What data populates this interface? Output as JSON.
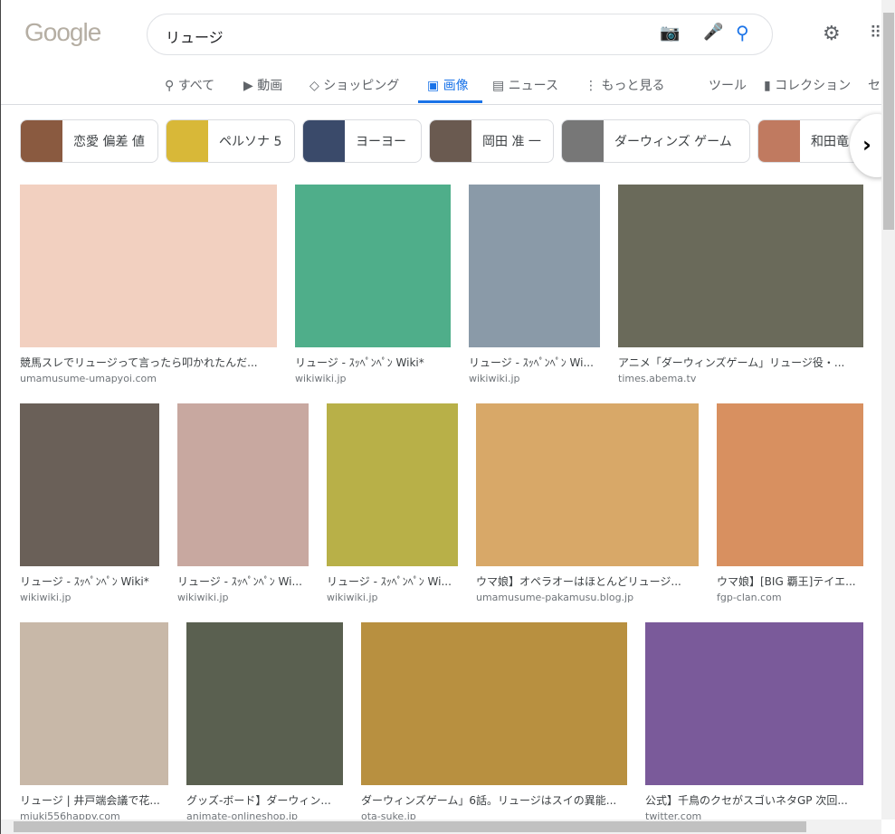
{
  "logo": "Google",
  "search": {
    "query": "リュージ"
  },
  "tabs": [
    {
      "label": "すべて",
      "icon": "search-icon"
    },
    {
      "label": "動画",
      "icon": "play-icon"
    },
    {
      "label": "ショッピング",
      "icon": "tag-icon"
    },
    {
      "label": "画像",
      "icon": "image-icon",
      "active": true
    },
    {
      "label": "ニュース",
      "icon": "news-icon"
    },
    {
      "label": "もっと見る",
      "icon": "more-icon"
    }
  ],
  "tools": {
    "tools": "ツール",
    "collection": "コレクション",
    "safe": "セ"
  },
  "chips": [
    {
      "label": "恋愛 偏差 値",
      "color": "#8a5a40"
    },
    {
      "label": "ペルソナ 5",
      "color": "#d8b838"
    },
    {
      "label": "ヨーヨー",
      "color": "#3a4a6a"
    },
    {
      "label": "岡田 准 一",
      "color": "#6a5a50"
    },
    {
      "label": "ダーウィンズ ゲーム",
      "color": "#777777"
    },
    {
      "label": "和田竜",
      "color": "#c07a60"
    }
  ],
  "results": [
    {
      "title": "競馬スレでリュージって言ったら叩かれたんだ...",
      "source": "umamusume-umapyoi.com",
      "color": "#f2d0c0"
    },
    {
      "title": "リュージ - ｽｯﾍﾟﾝﾍﾟﾝ Wiki*",
      "source": "wikiwiki.jp",
      "color": "#4fae8a"
    },
    {
      "title": "リュージ - ｽｯﾍﾟﾝﾍﾟﾝ Wi...",
      "source": "wikiwiki.jp",
      "color": "#8a9aa8"
    },
    {
      "title": "アニメ「ダーウィンズゲーム」リュージ役・...",
      "source": "times.abema.tv",
      "color": "#6a6a5a"
    },
    {
      "title": "リュージ - ｽｯﾍﾟﾝﾍﾟﾝ Wiki*",
      "source": "wikiwiki.jp",
      "color": "#6a6058"
    },
    {
      "title": "リュージ - ｽｯﾍﾟﾝﾍﾟﾝ Wi...",
      "source": "wikiwiki.jp",
      "color": "#c8a8a0"
    },
    {
      "title": "リュージ - ｽｯﾍﾟﾝﾍﾟﾝ Wi...",
      "source": "wikiwiki.jp",
      "color": "#b8b048"
    },
    {
      "title": "ウマ娘】オペラオーはほとんどリュージ...",
      "source": "umamusume-pakamusu.blog.jp",
      "color": "#d8a868"
    },
    {
      "title": "ウマ娘】[BIG 覇王]テイエ...",
      "source": "fgp-clan.com",
      "color": "#d89060"
    },
    {
      "title": "リュージ | 井戸端会議で花...",
      "source": "miuki556happy.com",
      "color": "#c8b8a8"
    },
    {
      "title": "グッズ-ボード】ダーウィン...",
      "source": "animate-onlineshop.jp",
      "color": "#5a6050"
    },
    {
      "title": "ダーウィンズゲーム」6話。リュージはスイの異能...",
      "source": "ota-suke.jp",
      "color": "#b89040"
    },
    {
      "title": "公式】千鳥のクセがスゴいネタGP 次回...",
      "source": "twitter.com",
      "color": "#7a5a9a"
    }
  ]
}
